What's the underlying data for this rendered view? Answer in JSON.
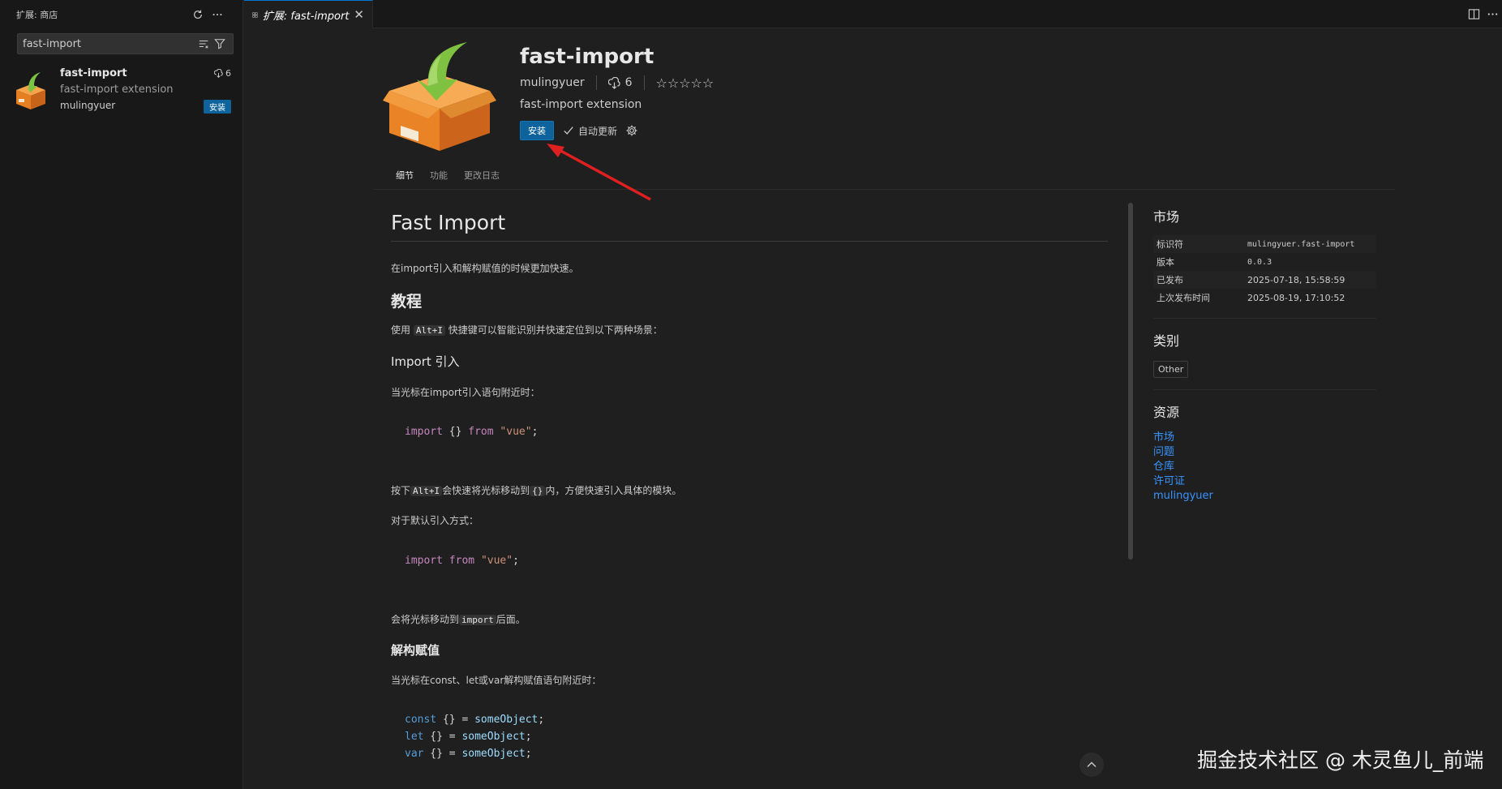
{
  "sidebar": {
    "title": "扩展: 商店",
    "search_value": "fast-import",
    "item": {
      "name": "fast-import",
      "description": "fast-import extension",
      "publisher": "mulingyuer",
      "downloads": "6",
      "install_label": "安装"
    }
  },
  "tab": {
    "label": "扩展: fast-import"
  },
  "extension": {
    "name": "fast-import",
    "publisher": "mulingyuer",
    "downloads": "6",
    "rating_stars": "☆☆☆☆☆",
    "description": "fast-import extension",
    "install_label": "安装",
    "auto_update_label": "自动更新"
  },
  "nav_tabs": [
    "细节",
    "功能",
    "更改日志"
  ],
  "readme": {
    "title": "Fast Import",
    "intro": "在import引入和解构赋值的时候更加快速。",
    "h_tutorial": "教程",
    "p_use_prefix": "使用",
    "shortcut": "Alt+I",
    "p_use_suffix": "快捷键可以智能识别并快速定位到以下两种场景：",
    "h_import": "Import 引入",
    "p_import_ctx": "当光标在import引入语句附近时：",
    "code1": {
      "kw1": "import",
      "braces": "{}",
      "kw2": "from",
      "str": "\"vue\"",
      "end": ";"
    },
    "p_press_prefix": "按下",
    "p_press_mid": "会快速将光标移动到",
    "braces_code": "{}",
    "p_press_suffix": "内，方便快速引入具体的模块。",
    "p_default": "对于默认引入方式：",
    "code2": {
      "kw1": "import",
      "kw2": "from",
      "str": "\"vue\"",
      "end": ";"
    },
    "p_move_prefix": "会将光标移动到",
    "import_code": "import",
    "p_move_suffix": "后面。",
    "h_destructure": "解构赋值",
    "p_destructure_ctx": "当光标在const、let或var解构赋值语句附近时：",
    "code3": [
      {
        "kw": "const",
        "rest": " {} = ",
        "obj": "someObject",
        "end": ";"
      },
      {
        "kw": "let",
        "rest": " {} = ",
        "obj": "someObject",
        "end": ";"
      },
      {
        "kw": "var",
        "rest": " {} = ",
        "obj": "someObject",
        "end": ";"
      }
    ]
  },
  "marketplace": {
    "title": "市场",
    "rows": [
      {
        "key": "标识符",
        "value": "mulingyuer.fast-import"
      },
      {
        "key": "版本",
        "value": "0.0.3"
      },
      {
        "key": "已发布",
        "value": "2025-07-18, 15:58:59"
      },
      {
        "key": "上次发布时间",
        "value": "2025-08-19, 17:10:52"
      }
    ]
  },
  "categories": {
    "title": "类别",
    "items": [
      "Other"
    ]
  },
  "resources": {
    "title": "资源",
    "links": [
      "市场",
      "问题",
      "仓库",
      "许可证",
      "mulingyuer"
    ]
  },
  "watermark": "掘金技术社区 @ 木灵鱼儿_前端",
  "colors": {
    "accent": "#0078d4",
    "install_button": "#0e639c",
    "link": "#3794ff",
    "arrow": "#e02020"
  },
  "icons": [
    "refresh-icon",
    "more-icon",
    "filter-list-icon",
    "filter-icon",
    "extensions-icon",
    "close-icon",
    "split-editor-icon",
    "download-icon",
    "check-icon",
    "gear-icon",
    "chevron-up-icon"
  ]
}
